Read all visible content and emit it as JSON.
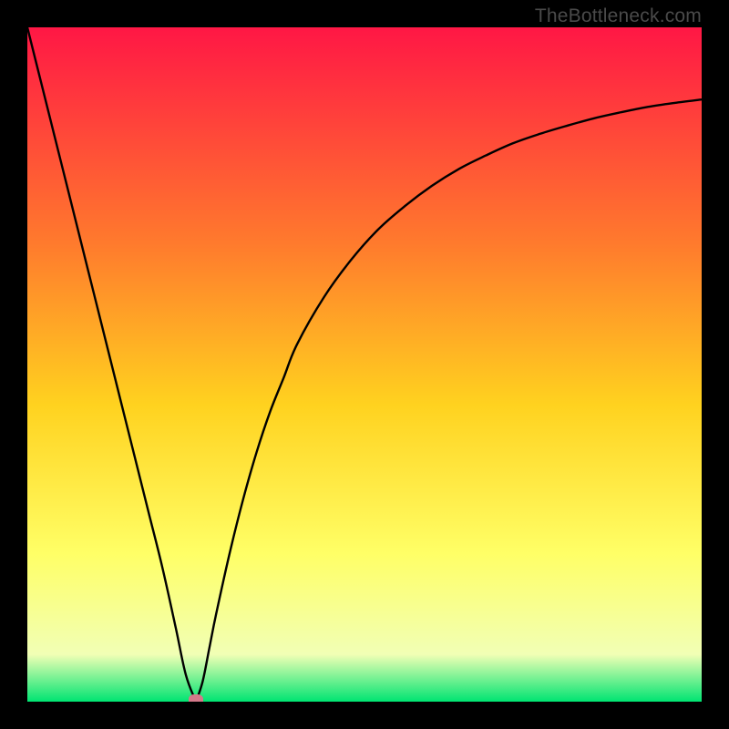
{
  "watermark": "TheBottleneck.com",
  "chart_data": {
    "type": "line",
    "title": "",
    "xlabel": "",
    "ylabel": "",
    "xlim": [
      0,
      100
    ],
    "ylim": [
      0,
      100
    ],
    "grid": false,
    "legend": false,
    "background_gradient": {
      "top": "#ff1745",
      "mid_upper": "#ff7a2d",
      "mid": "#ffd21f",
      "mid_lower": "#ffff66",
      "near_bottom": "#f1ffb5",
      "bottom": "#00e472"
    },
    "series": [
      {
        "name": "bottleneck-curve",
        "x": [
          0,
          2,
          4,
          6,
          8,
          10,
          12,
          14,
          16,
          18,
          20,
          22,
          23.5,
          25,
          26,
          27,
          28,
          30,
          32,
          34,
          36,
          38,
          40,
          44,
          48,
          52,
          56,
          60,
          64,
          68,
          72,
          76,
          80,
          84,
          88,
          92,
          96,
          100
        ],
        "y": [
          100,
          92,
          84,
          76,
          68,
          60,
          52,
          44,
          36,
          28,
          20,
          11,
          4,
          0,
          3,
          8,
          13,
          22,
          30,
          37,
          43,
          48,
          53,
          60,
          65.5,
          70,
          73.5,
          76.5,
          79,
          81,
          82.8,
          84.2,
          85.4,
          86.5,
          87.4,
          88.2,
          88.8,
          89.3
        ]
      }
    ],
    "marker": {
      "x": 25,
      "y": 0,
      "color": "#d5798a"
    }
  },
  "colors": {
    "frame_border": "#000000",
    "curve_stroke": "#000000"
  }
}
